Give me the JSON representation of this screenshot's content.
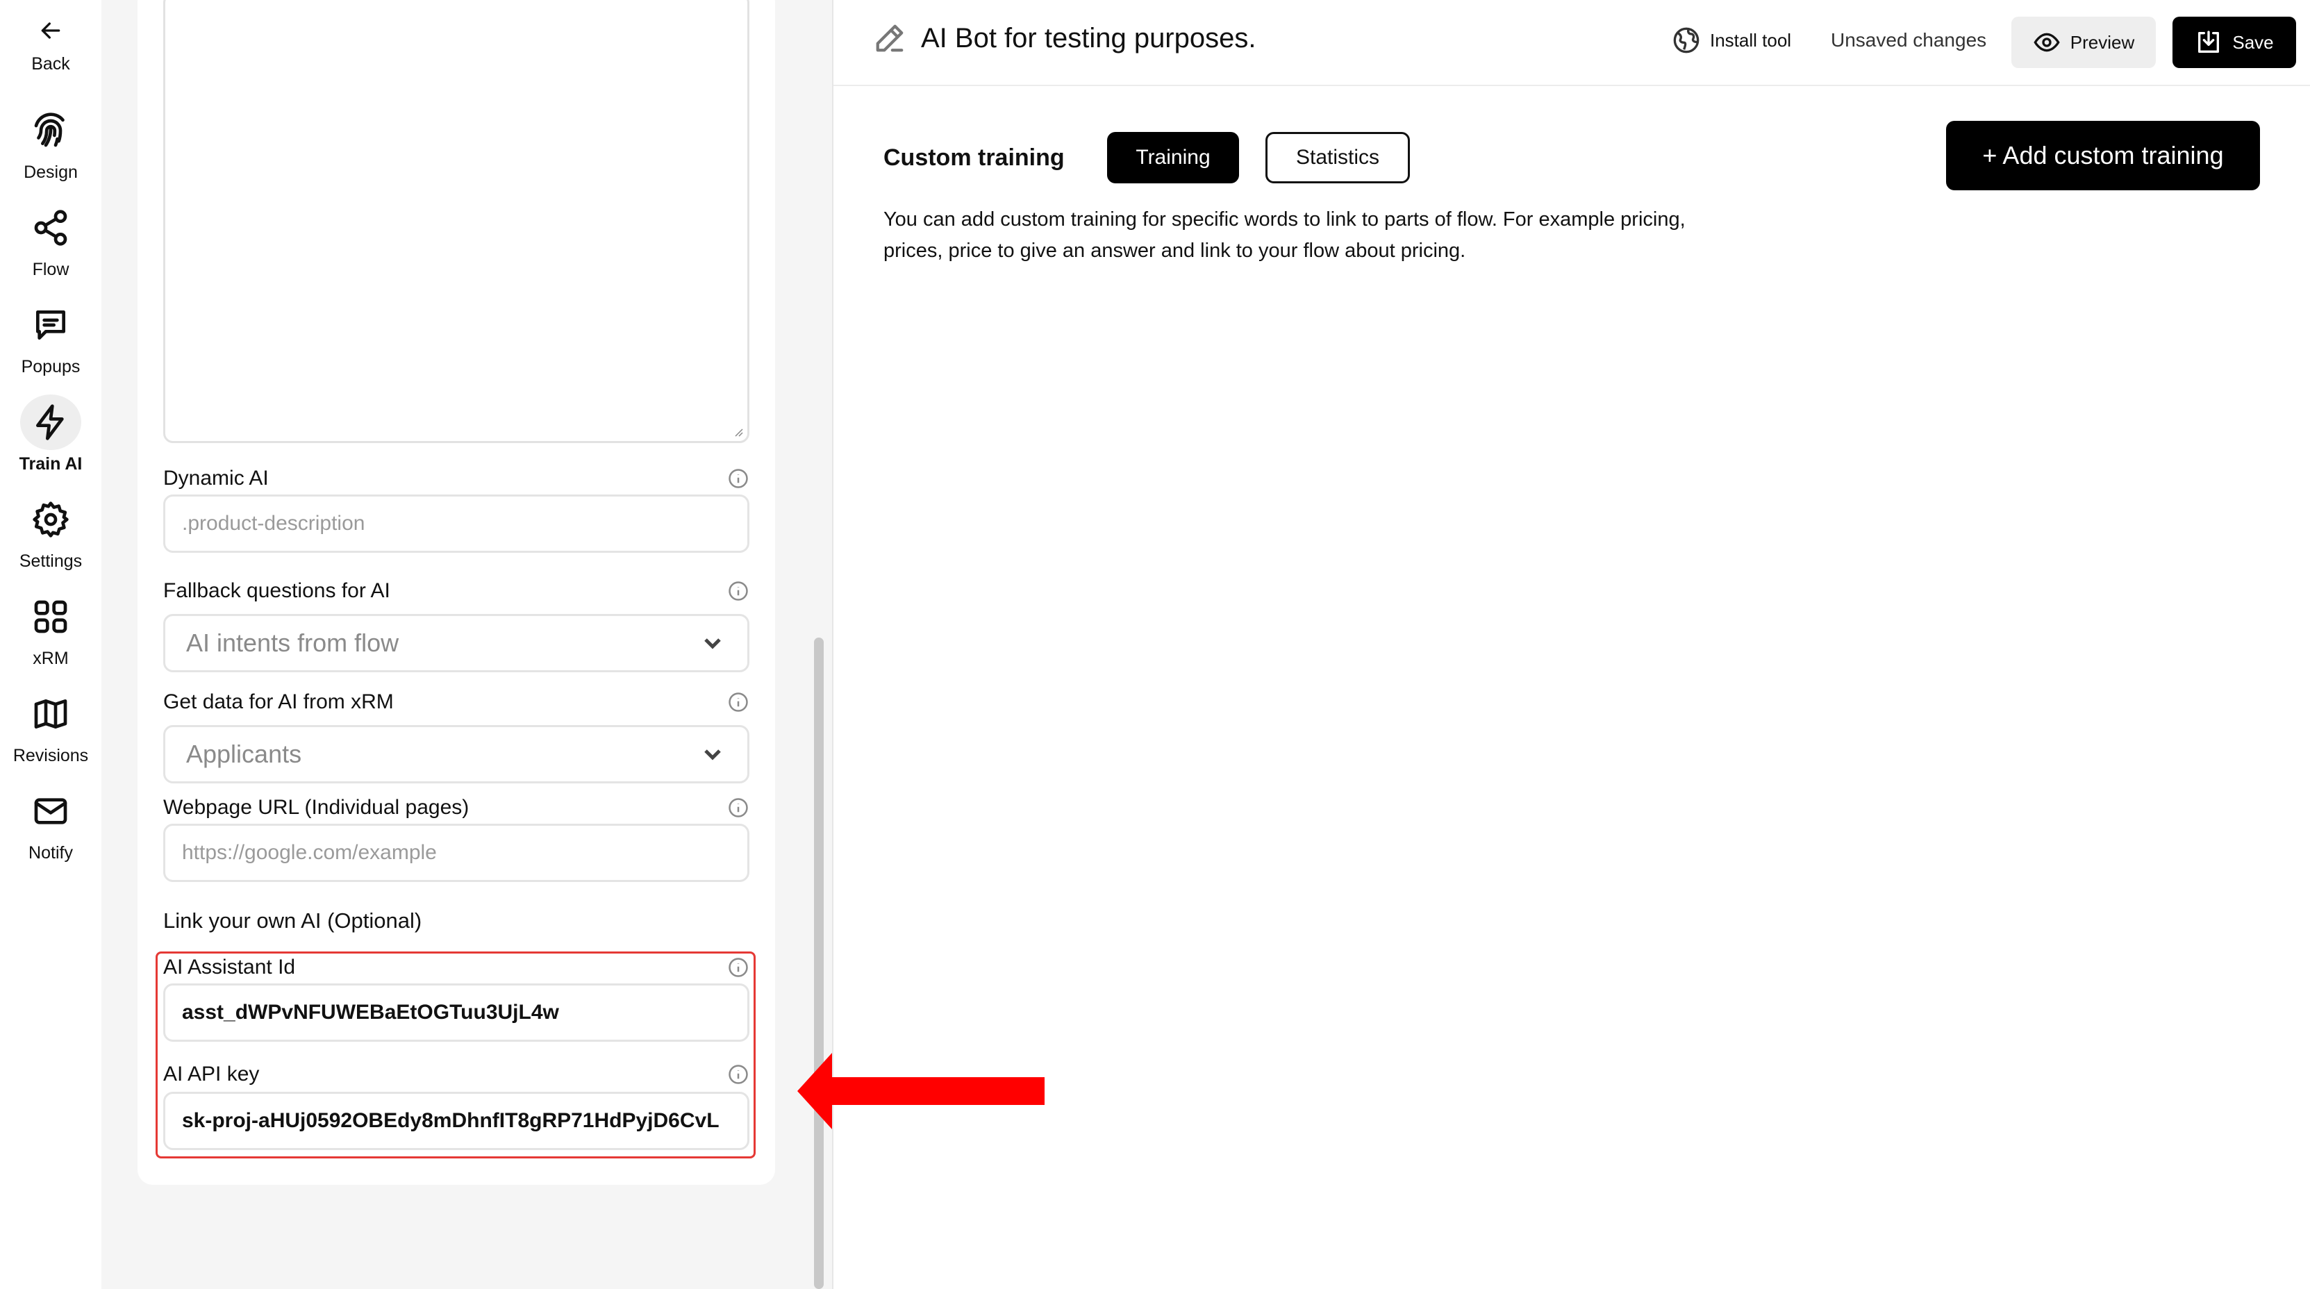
{
  "nav": {
    "back": "Back",
    "items": [
      {
        "label": "Design",
        "icon": "fingerprint-icon"
      },
      {
        "label": "Flow",
        "icon": "share-nodes-icon"
      },
      {
        "label": "Popups",
        "icon": "message-icon"
      },
      {
        "label": "Train AI",
        "icon": "lightning-icon",
        "active": true
      },
      {
        "label": "Settings",
        "icon": "gear-icon"
      },
      {
        "label": "xRM",
        "icon": "grid-icon"
      },
      {
        "label": "Revisions",
        "icon": "map-icon"
      },
      {
        "label": "Notify",
        "icon": "mail-icon"
      }
    ]
  },
  "panel": {
    "dynamic_ai": {
      "label": "Dynamic AI",
      "placeholder": ".product-description"
    },
    "fallback": {
      "label": "Fallback questions for AI",
      "value": "AI intents from flow"
    },
    "xrm": {
      "label": "Get data for AI from xRM",
      "value": "Applicants"
    },
    "webpage": {
      "label": "Webpage URL (Individual pages)",
      "placeholder": "https://google.com/example"
    },
    "link_own_ai": "Link your own AI (Optional)",
    "assistant_id": {
      "label": "AI Assistant Id",
      "value": "asst_dWPvNFUWEBaEtOGTuu3UjL4w"
    },
    "api_key": {
      "label": "AI API key",
      "value": "sk-proj-aHUj0592OBEdy8mDhnfIT8gRP71HdPyjD6CvL"
    }
  },
  "header": {
    "title": "AI Bot for testing purposes.",
    "install_tool": "Install tool",
    "unsaved": "Unsaved changes",
    "preview": "Preview",
    "save": "Save"
  },
  "main": {
    "section_title": "Custom training",
    "tabs": [
      {
        "label": "Training",
        "active": true
      },
      {
        "label": "Statistics",
        "active": false
      }
    ],
    "add_button": "+ Add custom training",
    "description": "You can add custom training for specific words to link to parts of flow. For example pricing, prices, price to give an answer and link to your flow about pricing."
  },
  "colors": {
    "highlight": "#e53935",
    "arrow": "#ff0000",
    "primary": "#000000"
  }
}
